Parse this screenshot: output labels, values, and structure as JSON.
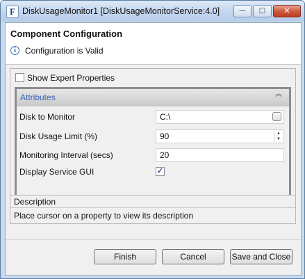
{
  "window": {
    "title": "DiskUsageMonitor1 [DiskUsageMonitorService:4.0]",
    "app_icon_glyph": "F",
    "controls": {
      "minimize": "—",
      "maximize": "□",
      "close": "✕"
    }
  },
  "header": {
    "title": "Component Configuration",
    "status": "Configuration is Valid",
    "info_glyph": "i"
  },
  "options": {
    "show_expert_label": "Show Expert Properties",
    "show_expert_checked": false
  },
  "attributes": {
    "title": "Attributes",
    "collapse_glyph": "︽",
    "rows": [
      {
        "label": "Disk to Monitor",
        "value": "C:\\"
      },
      {
        "label": "Disk Usage Limit (%)",
        "value": "90"
      },
      {
        "label": "Monitoring Interval (secs)",
        "value": "20"
      },
      {
        "label": "Display Service GUI",
        "checked": true,
        "check_glyph": "✓"
      }
    ],
    "spin_up": "▲",
    "spin_down": "▼"
  },
  "description": {
    "title": "Description",
    "text": "Place cursor on a property to view its description"
  },
  "buttons": {
    "finish": "Finish",
    "cancel": "Cancel",
    "save_close": "Save and Close"
  },
  "colors": {
    "attributes_title": "#3b63b8",
    "window_frame": "#c9daf0",
    "close_button": "#cf5a3f"
  }
}
